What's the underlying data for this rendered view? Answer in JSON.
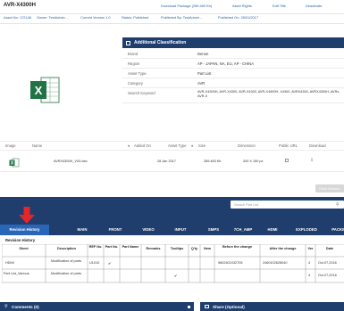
{
  "header": {
    "title": "AVR-X4300H",
    "actions": {
      "download": "Download Package (289.483 Kb)",
      "asset_rights": "Asset Rights",
      "edit_title": "Edit Title",
      "deactivate": "Deactivate"
    },
    "meta": {
      "asset_no": "Asset No: 172146",
      "owner": "Owner: TestAdmin ...",
      "current_version": "Current Version 1.0",
      "status": "Status: Published",
      "published_by": "Published By: TestAdmin ...",
      "published_on": "Published On: 28/01/2017"
    }
  },
  "classification": {
    "title": "Additional Classification",
    "rows": [
      {
        "label": "Brand",
        "value": "Denon"
      },
      {
        "label": "Region",
        "value": "AP - JAPAN, NA, EU, AP - CHINA"
      },
      {
        "label": "Asset Type",
        "value": "Part List"
      },
      {
        "label": "Category",
        "value": "AVR"
      },
      {
        "label": "Search Keyword",
        "value": "AVR-X4300H, AVR-X4300, AVR-X4300, AVR-X4300H, X4300, AVRX4300, AVRX4300H, AVRx, AVR-X"
      }
    ]
  },
  "file_table": {
    "headers": [
      "Image",
      "Name",
      "Added On",
      "Asset Type",
      "Size",
      "Dimension",
      "Public URL",
      "Download"
    ],
    "row": {
      "name": "AVRX4300H_V03.xlsx",
      "added_on": "28 Jan 2017",
      "size": "289.483 Kb",
      "dimension": "200 X 150 px"
    },
    "button_label": "Close Window"
  },
  "search": {
    "placeholder": "Search Part List"
  },
  "tabs": [
    "Revision History",
    "MAIN",
    "FRONT",
    "VIDEO",
    "INPUT",
    "SMPS",
    "7CH_AMP",
    "HDMI",
    "EXPLODED",
    "PACKING"
  ],
  "revision": {
    "caption": "Revision History",
    "headers": [
      "Sheet",
      "Description",
      "REF No.",
      "Part No.",
      "Part Name",
      "Remarks",
      "Tooltips",
      "Q'ty",
      "New",
      "Before the change",
      "After the change",
      "Ver",
      "Date"
    ],
    "rows": [
      {
        "sheet": "HDMI",
        "description": "Modification of parts",
        "ref": "U1010",
        "part_no": "✔",
        "part_name": "",
        "remarks": "",
        "tooltips": "",
        "qty": "",
        "new": "",
        "before": "9602401032705",
        "after": "2460102628040",
        "ver": "4",
        "date": "Oct.07,2016"
      },
      {
        "sheet": "Part List_Various",
        "description": "Modification of parts",
        "ref": "",
        "part_no": "",
        "part_name": "",
        "remarks": "",
        "tooltips": "✔",
        "qty": "",
        "new": "",
        "before": "",
        "after": "",
        "ver": "4",
        "date": "Oct.07,2016"
      }
    ]
  },
  "footer": {
    "comments": "Comments (0)",
    "share": "Share (Optional)"
  },
  "colors": {
    "navy": "#1f3d6d",
    "tab_active": "#2a66b8",
    "annotation_arrow": "#e3262a",
    "excel_green": "#217346"
  }
}
